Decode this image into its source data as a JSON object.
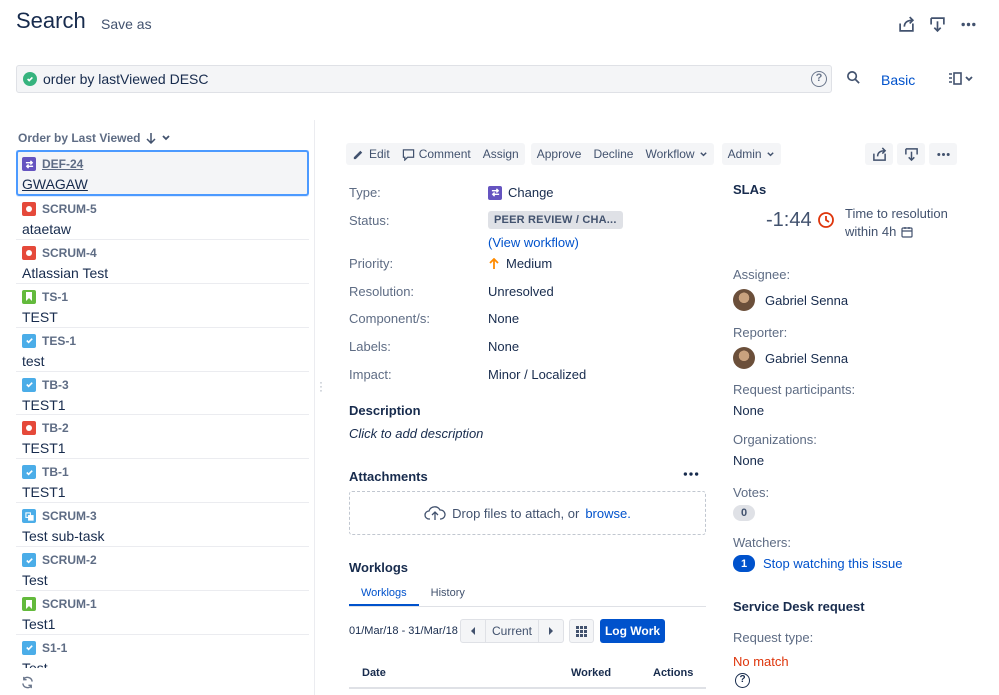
{
  "header": {
    "title": "Search",
    "save_as": "Save as"
  },
  "jql": {
    "query": "order by lastViewed DESC",
    "mode_link": "Basic"
  },
  "list": {
    "order_label": "Order by Last Viewed",
    "items": [
      {
        "key": "DEF-24",
        "summary": "GWAGAW",
        "type": "change"
      },
      {
        "key": "SCRUM-5",
        "summary": "ataetaw",
        "type": "bug"
      },
      {
        "key": "SCRUM-4",
        "summary": "Atlassian Test",
        "type": "bug"
      },
      {
        "key": "TS-1",
        "summary": "TEST",
        "type": "story"
      },
      {
        "key": "TES-1",
        "summary": "test",
        "type": "task"
      },
      {
        "key": "TB-3",
        "summary": "TEST1",
        "type": "task"
      },
      {
        "key": "TB-2",
        "summary": "TEST1",
        "type": "bug"
      },
      {
        "key": "TB-1",
        "summary": "TEST1",
        "type": "task"
      },
      {
        "key": "SCRUM-3",
        "summary": "Test sub-task",
        "type": "subtask"
      },
      {
        "key": "SCRUM-2",
        "summary": "Test",
        "type": "task"
      },
      {
        "key": "SCRUM-1",
        "summary": "Test1",
        "type": "story"
      },
      {
        "key": "S1-1",
        "summary": "Test",
        "type": "task"
      }
    ]
  },
  "toolbar": {
    "edit": "Edit",
    "comment": "Comment",
    "assign": "Assign",
    "approve": "Approve",
    "decline": "Decline",
    "workflow": "Workflow",
    "admin": "Admin"
  },
  "details": {
    "type_label": "Type:",
    "type_value": "Change",
    "status_label": "Status:",
    "status_value": "PEER REVIEW / CHA...",
    "view_workflow": "View workflow",
    "priority_label": "Priority:",
    "priority_value": "Medium",
    "resolution_label": "Resolution:",
    "resolution_value": "Unresolved",
    "components_label": "Component/s:",
    "components_value": "None",
    "labels_label": "Labels:",
    "labels_value": "None",
    "impact_label": "Impact:",
    "impact_value": "Minor / Localized"
  },
  "description": {
    "heading": "Description",
    "placeholder": "Click to add description"
  },
  "attachments": {
    "heading": "Attachments",
    "drop_text": "Drop files to attach, or",
    "browse": "browse."
  },
  "worklogs": {
    "heading": "Worklogs",
    "tab_worklogs": "Worklogs",
    "tab_history": "History",
    "date_range": "01/Mar/18 - 31/Mar/18",
    "current": "Current",
    "log_work": "Log Work",
    "col_date": "Date",
    "col_worked": "Worked",
    "col_actions": "Actions"
  },
  "sidebar": {
    "slas_heading": "SLAs",
    "sla_time": "-1:44",
    "sla_name": "Time to resolution",
    "sla_goal": "within 4h",
    "assignee_label": "Assignee:",
    "assignee": "Gabriel Senna",
    "reporter_label": "Reporter:",
    "reporter": "Gabriel Senna",
    "participants_label": "Request participants:",
    "participants": "None",
    "organizations_label": "Organizations:",
    "organizations": "None",
    "votes_label": "Votes:",
    "votes": "0",
    "watchers_label": "Watchers:",
    "watchers": "1",
    "stop_watching": "Stop watching this issue",
    "sd_heading": "Service Desk request",
    "request_type_label": "Request type:",
    "request_type": "No match"
  },
  "colors": {
    "accent": "#0052cc",
    "danger": "#de350b",
    "success": "#36b37e",
    "change": "#6554c0",
    "bug": "#e5493a",
    "story": "#63ba3c",
    "task": "#4bade8"
  }
}
